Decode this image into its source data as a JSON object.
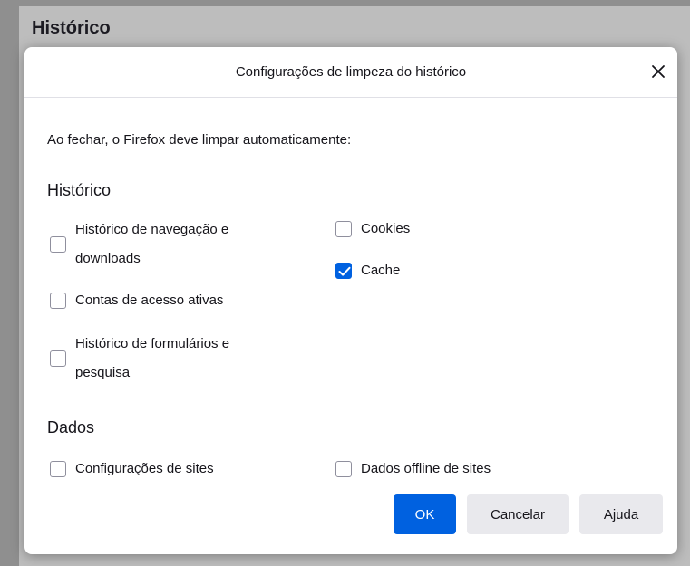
{
  "background": {
    "title": "Histórico"
  },
  "dialog": {
    "title": "Configurações de limpeza do histórico",
    "intro": "Ao fechar, o Firefox deve limpar automaticamente:",
    "history_section": "Histórico",
    "data_section": "Dados",
    "options": {
      "browsing": {
        "line1": "Histórico de navegação e",
        "line2": "downloads",
        "checked": false
      },
      "logins": {
        "label": "Contas de acesso ativas",
        "checked": false
      },
      "forms": {
        "line1": "Histórico de formulários e",
        "line2": "pesquisa",
        "checked": false
      },
      "cookies": {
        "label": "Cookies",
        "checked": false
      },
      "cache": {
        "label": "Cache",
        "checked": true
      },
      "site_settings": {
        "label": "Configurações de sites",
        "checked": false
      },
      "offline_data": {
        "label": "Dados offline de sites",
        "checked": false
      }
    },
    "buttons": {
      "ok": "OK",
      "cancel": "Cancelar",
      "help": "Ajuda"
    }
  },
  "colors": {
    "accent": "#0061e0",
    "button_bg": "#e9e9ed"
  }
}
